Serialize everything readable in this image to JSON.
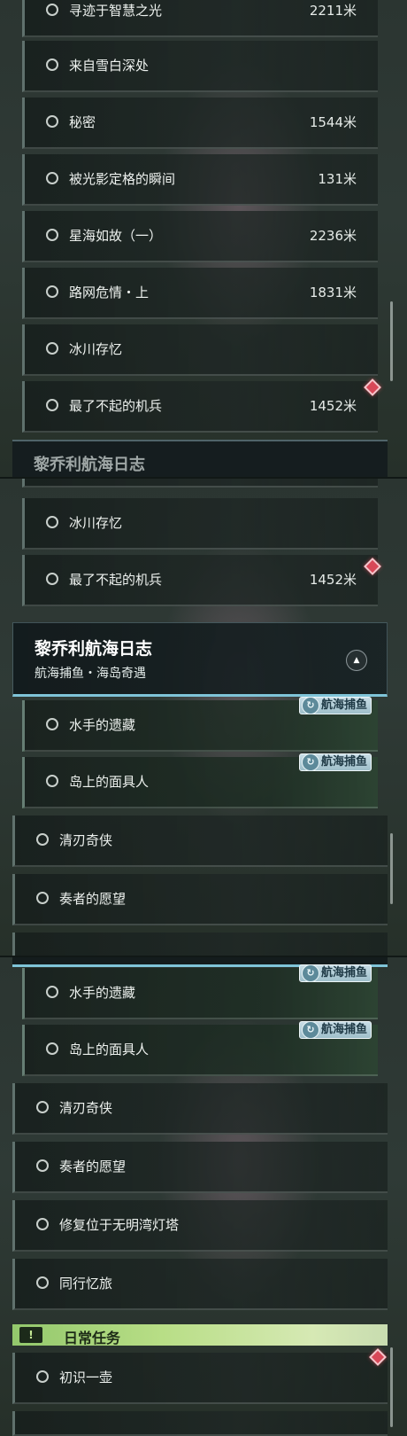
{
  "distance_unit": "米",
  "panel1": {
    "rows": [
      {
        "label": "寻迹于智慧之光",
        "distance": "2211米"
      },
      {
        "label": "来自雪白深处",
        "distance": ""
      },
      {
        "label": "秘密",
        "distance": "1544米"
      },
      {
        "label": "被光影定格的瞬间",
        "distance": "131米"
      },
      {
        "label": "星海如故（一）",
        "distance": "2236米"
      },
      {
        "label": "路网危情・上",
        "distance": "1831米"
      },
      {
        "label": "冰川存忆",
        "distance": ""
      },
      {
        "label": "最了不起的机兵",
        "distance": "1452米"
      }
    ],
    "cut_title": "黎乔利航海日志"
  },
  "panel2": {
    "rows_top": [
      {
        "label": "冰川存忆",
        "distance": ""
      },
      {
        "label": "最了不起的机兵",
        "distance": "1452米"
      }
    ],
    "group": {
      "title": "黎乔利航海日志",
      "subtitle": "航海捕鱼・海岛奇遇",
      "toggle_icon": "chevron-up-icon"
    },
    "tag_label": "航海捕鱼",
    "rows_sub": [
      {
        "label": "水手的遗藏"
      },
      {
        "label": "岛上的面具人"
      }
    ],
    "rows_main": [
      {
        "label": "清刃奇侠"
      },
      {
        "label": "奏者的愿望"
      }
    ]
  },
  "panel3": {
    "tag_label": "航海捕鱼",
    "rows_sub": [
      {
        "label": "水手的遗藏"
      },
      {
        "label": "岛上的面具人"
      }
    ],
    "rows_main": [
      {
        "label": "清刃奇侠"
      },
      {
        "label": "奏者的愿望"
      },
      {
        "label": "修复位于无明湾灯塔"
      },
      {
        "label": "同行忆旅"
      }
    ],
    "daily": {
      "icon": "!",
      "title": "日常任务"
    },
    "daily_rows": [
      {
        "label": "初识一壶"
      }
    ]
  },
  "colors": {
    "accent_green": "#b8de86",
    "marker_red": "#d84858",
    "group_line": "#7fc4d8"
  }
}
